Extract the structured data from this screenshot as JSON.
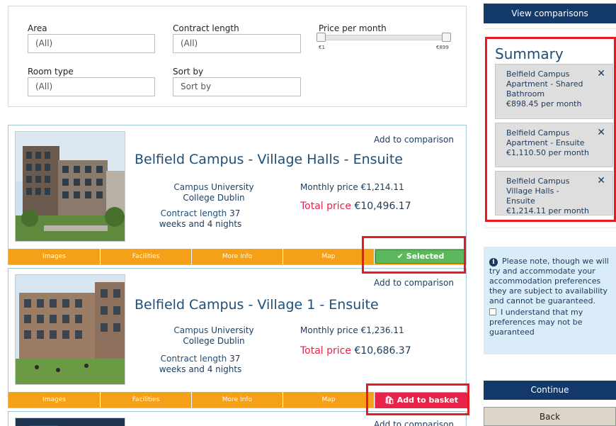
{
  "filters": {
    "area_label": "Area",
    "area_value": "(All)",
    "contract_label": "Contract length",
    "contract_value": "(All)",
    "price_label": "Price per month",
    "price_min": "€1",
    "price_max": "€899",
    "room_label": "Room type",
    "room_value": "(All)",
    "sort_label": "Sort by",
    "sort_value": "Sort by"
  },
  "listings": [
    {
      "add_compare": "Add to comparison",
      "title": "Belfield Campus - Village Halls - Ensuite",
      "campus_key": "Campus",
      "campus_value": "University College Dublin",
      "contract_key": "Contract length",
      "contract_value": "37 weeks and 4 nights",
      "monthly_key": "Monthly price",
      "monthly_value": "€1,214.11",
      "total_key": "Total price",
      "total_value": "€10,496.17",
      "action_label": "✔ Selected"
    },
    {
      "add_compare": "Add to comparison",
      "title": "Belfield Campus - Village 1 - Ensuite",
      "campus_key": "Campus",
      "campus_value": "University College Dublin",
      "contract_key": "Contract length",
      "contract_value": "37 weeks and 4 nights",
      "monthly_key": "Monthly price",
      "monthly_value": "€1,236.11",
      "total_key": "Total price",
      "total_value": "€10,686.37",
      "action_label": "🛍 Add to basket"
    },
    {
      "add_compare": "Add to comparison"
    }
  ],
  "tabs": [
    "Images",
    "Facilities",
    "More Info",
    "Map"
  ],
  "sidebar": {
    "view_comparisons": "View comparisons",
    "summary_title": "Summary",
    "summary_items": [
      {
        "name": "Belfield Campus Apartment - Shared Bathroom",
        "price": "€898.45 per month"
      },
      {
        "name": "Belfield Campus Apartment - Ensuite",
        "price": "€1,110.50 per month"
      },
      {
        "name": "Belfield Campus Village Halls - Ensuite",
        "price": "€1,214.11 per month"
      }
    ],
    "note": "Please note, though we will try and accommodate your accommodation preferences they are subject to availability and cannot be guaranteed.",
    "checkbox_label": "I understand that my preferences may not be guaranteed",
    "continue": "Continue",
    "back": "Back"
  },
  "colors": {
    "navy": "#133a6b",
    "orange": "#f5a019",
    "green": "#5cb85c",
    "pink": "#e8234a",
    "highlight": "#e41b23"
  }
}
